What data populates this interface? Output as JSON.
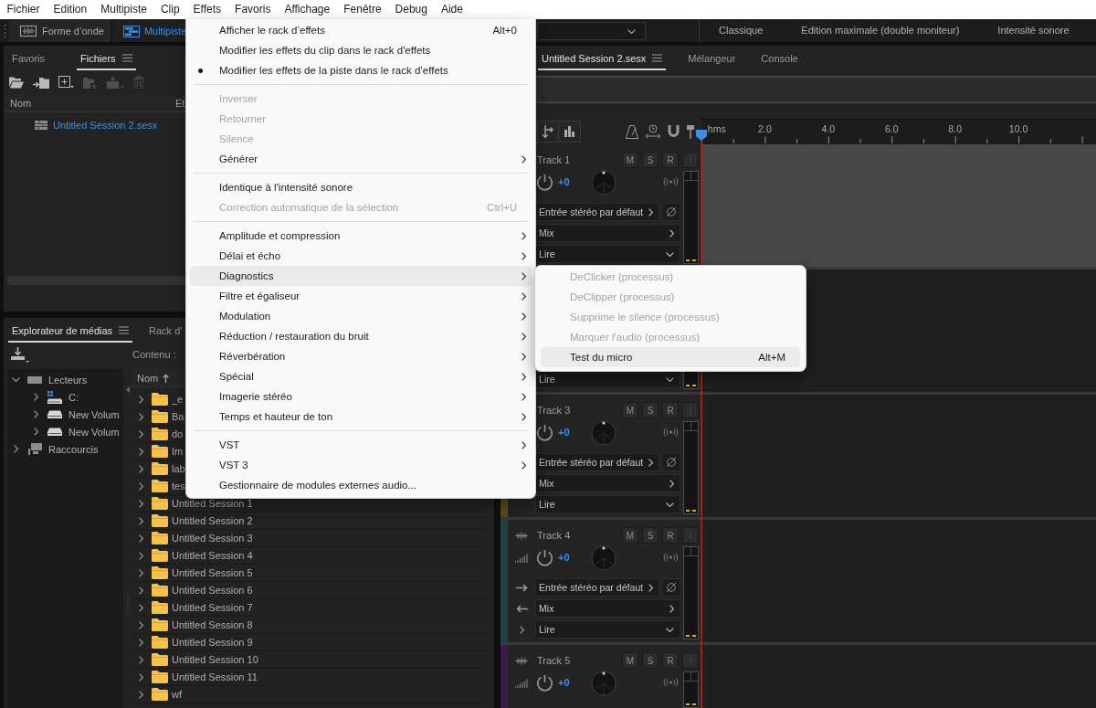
{
  "menu_bar": [
    "Fichier",
    "Edition",
    "Multipiste",
    "Clip",
    "Effets",
    "Favoris",
    "Affichage",
    "Fenêtre",
    "Debug",
    "Aide"
  ],
  "toolbar": {
    "views": [
      {
        "label": "Forme d’onde",
        "kind": "waveform",
        "selected": false
      },
      {
        "label": "Multipiste",
        "kind": "multitrack",
        "selected": true
      }
    ],
    "workspaces": [
      {
        "label": "Classique",
        "selected": false
      },
      {
        "label": "Edition maximale (double moniteur)",
        "selected": false
      },
      {
        "label": "Intensité sonore",
        "selected": false
      }
    ]
  },
  "files_panel": {
    "tabs": [
      {
        "label": "Favoris",
        "selected": false
      },
      {
        "label": "Fichiers",
        "selected": true
      }
    ],
    "tools": [
      {
        "kind": "open",
        "disabled": false
      },
      {
        "kind": "import",
        "disabled": false
      },
      {
        "kind": "new",
        "disabled": false
      },
      {
        "kind": "addfolder",
        "disabled": true
      },
      {
        "kind": "insert",
        "disabled": true
      },
      {
        "kind": "delete",
        "disabled": true
      }
    ],
    "columns": [
      "Nom",
      "Et"
    ],
    "files": [
      {
        "name": "Untitled Session 2.sesx",
        "open": true
      }
    ]
  },
  "media_panel": {
    "tabs": [
      {
        "label": "Explorateur de médias",
        "selected": true
      },
      {
        "label": "Rack d’",
        "selected": false
      }
    ],
    "content_label": "Contenu :",
    "tree": [
      {
        "label": "Lecteurs",
        "kind": "drives",
        "expanded": true,
        "children": [
          {
            "label": "C:",
            "kind": "system",
            "expanded": false
          },
          {
            "label": "New Volum",
            "kind": "drive",
            "expanded": false
          },
          {
            "label": "New Volum",
            "kind": "drive",
            "expanded": false
          }
        ]
      },
      {
        "label": "Raccourcis",
        "kind": "shortcuts",
        "expanded": false
      }
    ],
    "list_header": {
      "label": "Nom",
      "sorted_ascending": true
    },
    "rows": [
      {
        "name": "_e",
        "expanded": false
      },
      {
        "name": "Ba",
        "expanded": false
      },
      {
        "name": "do",
        "expanded": false
      },
      {
        "name": "Im",
        "expanded": false
      },
      {
        "name": "lab",
        "expanded": false
      },
      {
        "name": "tes",
        "expanded": false
      },
      {
        "name": "Untitled Session 1",
        "expanded": false
      },
      {
        "name": "Untitled Session 2",
        "expanded": false
      },
      {
        "name": "Untitled Session 3",
        "expanded": false
      },
      {
        "name": "Untitled Session 4",
        "expanded": false
      },
      {
        "name": "Untitled Session 5",
        "expanded": false
      },
      {
        "name": "Untitled Session 6",
        "expanded": false
      },
      {
        "name": "Untitled Session 7",
        "expanded": false
      },
      {
        "name": "Untitled Session 8",
        "expanded": false
      },
      {
        "name": "Untitled Session 9",
        "expanded": false
      },
      {
        "name": "Untitled Session 10",
        "expanded": false
      },
      {
        "name": "Untitled Session 11",
        "expanded": false
      },
      {
        "name": "wf",
        "expanded": false
      }
    ]
  },
  "editor": {
    "tabs": [
      {
        "label": "Untitled Session 2.sesx",
        "selected": true
      },
      {
        "label": "Mélangeur",
        "selected": false
      },
      {
        "label": "Console",
        "selected": false
      }
    ],
    "ruler": [
      "hms",
      "2.0",
      "4.0",
      "6.0",
      "8.0",
      "10.0"
    ],
    "tracks": [
      {
        "name": "Track 1",
        "selected": true,
        "buttons": [
          {
            "label": "M",
            "disabled": false
          },
          {
            "label": "S",
            "disabled": false
          },
          {
            "label": "R",
            "disabled": false
          },
          {
            "label": "I",
            "disabled": true
          }
        ],
        "volume": "+0",
        "input": "Entrée stéréo par défaut",
        "output": "Mix",
        "mode": "Lire"
      },
      {
        "selected": false,
        "mode": "Lire"
      },
      {
        "name": "Track 3",
        "selected": false,
        "color": "#5a4a18",
        "buttons": [
          {
            "label": "M",
            "disabled": false
          },
          {
            "label": "S",
            "disabled": false
          },
          {
            "label": "R",
            "disabled": false
          },
          {
            "label": "I",
            "disabled": true
          }
        ],
        "volume": "+0",
        "input": "Entrée stéréo par défaut",
        "output": "Mix",
        "mode": "Lire"
      },
      {
        "name": "Track 4",
        "selected": false,
        "color": "#1e4241",
        "buttons": [
          {
            "label": "M",
            "disabled": false
          },
          {
            "label": "S",
            "disabled": false
          },
          {
            "label": "R",
            "disabled": false
          },
          {
            "label": "I",
            "disabled": true
          }
        ],
        "volume": "+0",
        "input": "Entrée stéréo par défaut",
        "output": "Mix",
        "mode": "Lire"
      },
      {
        "name": "Track 5",
        "selected": false,
        "color": "#3b1d49",
        "buttons": [
          {
            "label": "M",
            "disabled": false
          },
          {
            "label": "S",
            "disabled": false
          },
          {
            "label": "R",
            "disabled": false
          },
          {
            "label": "I",
            "disabled": true
          }
        ],
        "volume": "+0"
      }
    ]
  },
  "effects_menu": {
    "sections": [
      {
        "items": [
          {
            "label": "Afficher le rack d’effets",
            "shortcut": "Alt+0",
            "checked": false,
            "disabled": false,
            "has_submenu": false,
            "selected": false
          },
          {
            "label": "Modifier les effets du clip dans le rack d'effets",
            "checked": false,
            "disabled": false,
            "has_submenu": false,
            "selected": false
          },
          {
            "label": "Modifier les effets de la piste dans le rack d’effets",
            "checked": true,
            "disabled": false,
            "has_submenu": false,
            "selected": false
          }
        ]
      },
      {
        "items": [
          {
            "label": "Inverser",
            "checked": false,
            "disabled": true,
            "has_submenu": false,
            "selected": false
          },
          {
            "label": "Retourner",
            "checked": false,
            "disabled": true,
            "has_submenu": false,
            "selected": false
          },
          {
            "label": "Silence",
            "checked": false,
            "disabled": true,
            "has_submenu": false,
            "selected": false
          },
          {
            "label": "Générer",
            "checked": false,
            "disabled": false,
            "has_submenu": true,
            "selected": false
          }
        ]
      },
      {
        "items": [
          {
            "label": "Identique à l'intensité sonore",
            "checked": false,
            "disabled": false,
            "has_submenu": false,
            "selected": false
          },
          {
            "label": "Correction automatique de la sélection",
            "shortcut": "Ctrl+U",
            "checked": false,
            "disabled": true,
            "has_submenu": false,
            "selected": false
          }
        ]
      },
      {
        "items": [
          {
            "label": "Amplitude et compression",
            "checked": false,
            "disabled": false,
            "has_submenu": true,
            "selected": false
          },
          {
            "label": "Délai et écho",
            "checked": false,
            "disabled": false,
            "has_submenu": true,
            "selected": false
          },
          {
            "label": "Diagnostics",
            "checked": false,
            "disabled": false,
            "has_submenu": true,
            "selected": true
          },
          {
            "label": "Filtre et égaliseur",
            "checked": false,
            "disabled": false,
            "has_submenu": true,
            "selected": false
          },
          {
            "label": "Modulation",
            "checked": false,
            "disabled": false,
            "has_submenu": true,
            "selected": false
          },
          {
            "label": "Réduction / restauration du bruit",
            "checked": false,
            "disabled": false,
            "has_submenu": true,
            "selected": false
          },
          {
            "label": "Réverbération",
            "checked": false,
            "disabled": false,
            "has_submenu": true,
            "selected": false
          },
          {
            "label": "Spécial",
            "checked": false,
            "disabled": false,
            "has_submenu": true,
            "selected": false
          },
          {
            "label": "Imagerie stéréo",
            "checked": false,
            "disabled": false,
            "has_submenu": true,
            "selected": false
          },
          {
            "label": "Temps et hauteur de ton",
            "checked": false,
            "disabled": false,
            "has_submenu": true,
            "selected": false
          }
        ]
      },
      {
        "items": [
          {
            "label": "VST",
            "checked": false,
            "disabled": false,
            "has_submenu": true,
            "selected": false
          },
          {
            "label": "VST 3",
            "checked": false,
            "disabled": false,
            "has_submenu": true,
            "selected": false
          },
          {
            "label": "Gestionnaire de modules externes audio...",
            "checked": false,
            "disabled": false,
            "has_submenu": false,
            "selected": false
          }
        ]
      }
    ]
  },
  "diagnostics_submenu": {
    "items": [
      {
        "label": "DeClicker (processus)",
        "checked": false,
        "disabled": true,
        "has_submenu": false,
        "selected": false
      },
      {
        "label": "DeClipper (processus)",
        "checked": false,
        "disabled": true,
        "has_submenu": false,
        "selected": false
      },
      {
        "label": "Supprime le silence (processus)",
        "checked": false,
        "disabled": true,
        "has_submenu": false,
        "selected": false
      },
      {
        "label": "Marquer l'audio (processus)",
        "checked": false,
        "disabled": true,
        "has_submenu": false,
        "selected": false
      },
      {
        "label": "Test du micro",
        "shortcut": "Alt+M",
        "checked": false,
        "disabled": false,
        "has_submenu": false,
        "selected": true
      }
    ]
  }
}
